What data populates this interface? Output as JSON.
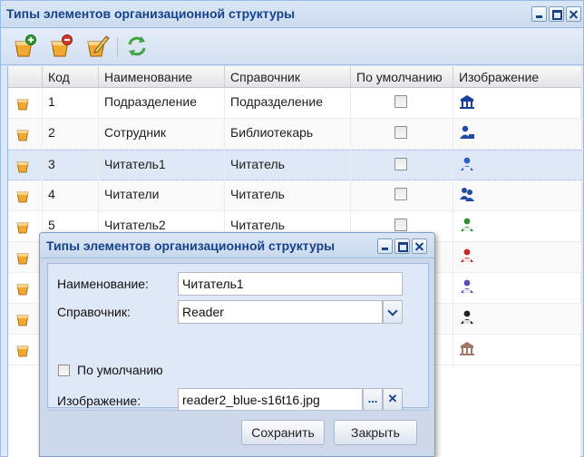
{
  "window": {
    "title": "Типы элементов организационной структуры"
  },
  "grid": {
    "columns": [
      "Код",
      "Наименование",
      "Справочник",
      "По умолчанию",
      "Изображение"
    ],
    "rows": [
      {
        "code": "1",
        "name": "Подразделение",
        "ref": "Подразделение",
        "default": false,
        "image": "building-icon",
        "color": "#1a3f9a"
      },
      {
        "code": "2",
        "name": "Сотрудник",
        "ref": "Библиотекарь",
        "default": false,
        "image": "employee-icon",
        "color": "#1f4aa5"
      },
      {
        "code": "3",
        "name": "Читатель1",
        "ref": "Читатель",
        "default": false,
        "image": "reader-blue-icon",
        "color": "#2b63c8",
        "selected": true
      },
      {
        "code": "4",
        "name": "Читатели",
        "ref": "Читатель",
        "default": false,
        "image": "readers-group-icon",
        "color": "#1f4aa5"
      },
      {
        "code": "5",
        "name": "Читатель2",
        "ref": "Читатель",
        "default": false,
        "image": "reader-green-icon",
        "color": "#2f8f2f"
      },
      {
        "image": "reader-red-icon",
        "color": "#c0282a"
      },
      {
        "image": "reader-purple-icon",
        "color": "#5a4bb8"
      },
      {
        "image": "reader-black-icon",
        "color": "#222222"
      },
      {
        "image": "library-icon",
        "color": "#a3786a"
      }
    ]
  },
  "dialog": {
    "title": "Типы элементов организационной структуры",
    "name_label": "Наименование:",
    "name_value": "Читатель1",
    "ref_label": "Справочник:",
    "ref_value": "Reader",
    "default_label": "По умолчанию",
    "default_checked": false,
    "image_label": "Изображение:",
    "image_value": "reader2_blue-s16t16.jpg",
    "browse_label": "...",
    "clear_label": "✕",
    "save_label": "Сохранить",
    "close_label": "Закрыть"
  }
}
